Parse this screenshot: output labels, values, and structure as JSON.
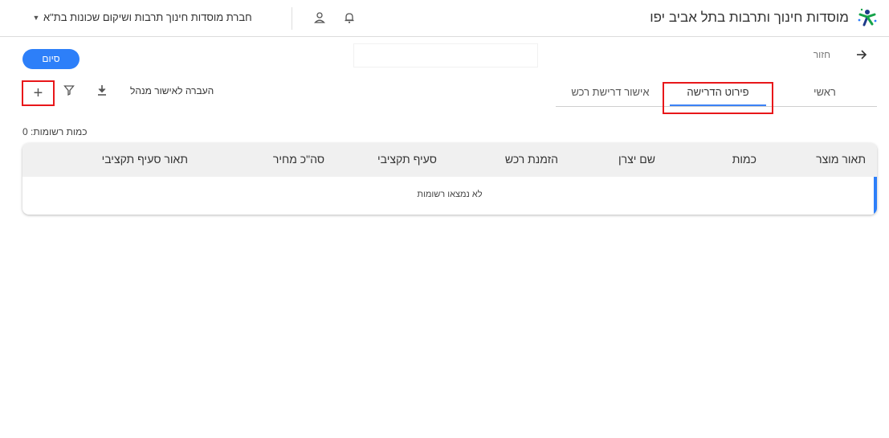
{
  "header": {
    "app_title": "מוסדות חינוך ותרבות בתל אביב יפו",
    "company": "חברת מוסדות חינוך תרבות ושיקום שכונות בת\"א",
    "caret": "▼",
    "icons": [
      "logo-icon",
      "user-icon",
      "bell-icon",
      "chevron-down-icon"
    ]
  },
  "top": {
    "back_label": "חזור",
    "finish_label": "סיום"
  },
  "tabs": [
    {
      "label": "ראשי"
    },
    {
      "label": "פירוט הדרישה"
    },
    {
      "label": "אישור דרישת רכש"
    }
  ],
  "active_tab": "פירוט הדרישה",
  "toolbar": {
    "add_symbol": "+",
    "transfer_label": "העברה לאישור מנהל",
    "icons": [
      "plus-icon",
      "filter-icon",
      "download-icon"
    ]
  },
  "records": {
    "count_label": "כמות רשומות: 0"
  },
  "table": {
    "columns": [
      "תאור מוצר",
      "כמות",
      "שם יצרן",
      "הזמנת רכש",
      "סעיף תקציבי",
      "סה\"כ מחיר",
      "תאור סעיף תקציבי"
    ],
    "empty_text": "לא נמצאו רשומות"
  },
  "colors": {
    "accent": "#2d7ff9",
    "highlight": "#e8171a",
    "header_row": "#f0f0f0"
  }
}
